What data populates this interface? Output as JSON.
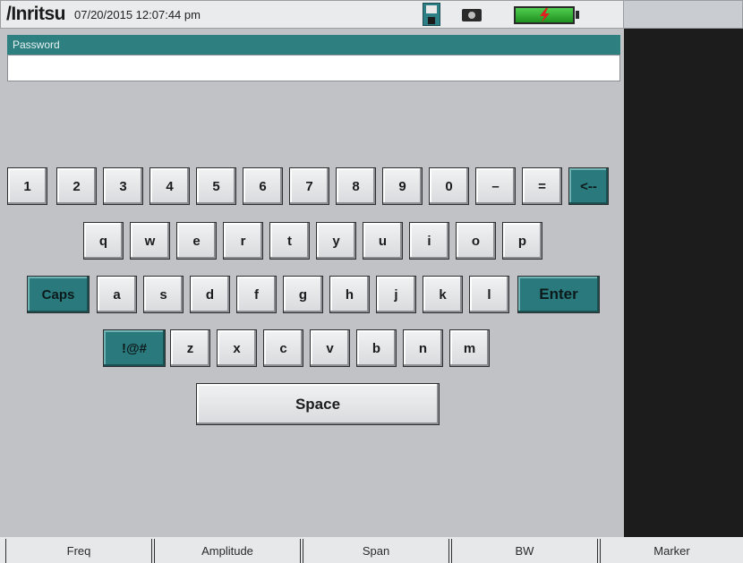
{
  "header": {
    "logo": "/Inritsu",
    "datetime": "07/20/2015 12:07:44 pm",
    "save_icon": "floppy-disk-icon",
    "camera_icon": "camera-icon",
    "battery_icon": "battery-charging-icon"
  },
  "password": {
    "label": "Password",
    "value": ""
  },
  "keyboard": {
    "row1": [
      "1",
      "2",
      "3",
      "4",
      "5",
      "6",
      "7",
      "8",
      "9",
      "0",
      "–",
      "=",
      "<--"
    ],
    "row2": [
      "q",
      "w",
      "e",
      "r",
      "t",
      "y",
      "u",
      "i",
      "o",
      "p"
    ],
    "row3": [
      "Caps",
      "a",
      "s",
      "d",
      "f",
      "g",
      "h",
      "j",
      "k",
      "l",
      "Enter"
    ],
    "row4": [
      "!@#",
      "z",
      "x",
      "c",
      "v",
      "b",
      "n",
      "m"
    ],
    "space": "Space"
  },
  "softkeys": [
    "Freq",
    "Amplitude",
    "Span",
    "BW",
    "Marker"
  ],
  "colors": {
    "accent_teal": "#2a7a7d",
    "background": "#c0c2c5",
    "side_panel": "#1c1c1c"
  }
}
